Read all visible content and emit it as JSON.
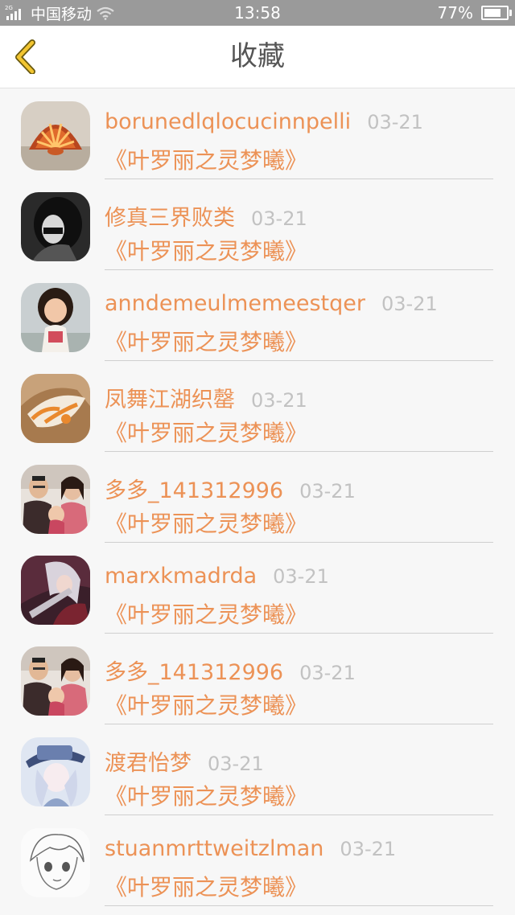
{
  "status_bar": {
    "network": "2G",
    "carrier": "中国移动",
    "time": "13:58",
    "battery": "77%",
    "battery_level": 0.77
  },
  "nav": {
    "title": "收藏",
    "back_icon": "chevron-left-icon",
    "accent_color": "#f1c40f"
  },
  "colors": {
    "accent": "#ec9256",
    "date": "#c2c2c2"
  },
  "items": [
    {
      "username": "borunedlqlocucinnpelli",
      "date": "03-21",
      "book": "《叶罗丽之灵梦曦》",
      "avatar": "seashell-avatar"
    },
    {
      "username": "修真三界败类",
      "date": "03-21",
      "book": "《叶罗丽之灵梦曦》",
      "avatar": "girl-bw-avatar"
    },
    {
      "username": "anndemeulmemeestqer",
      "date": "03-21",
      "book": "《叶罗丽之灵梦曦》",
      "avatar": "child-photo-avatar"
    },
    {
      "username": "凤舞江湖织罄",
      "date": "03-21",
      "book": "《叶罗丽之灵梦曦》",
      "avatar": "seashell-orange-avatar"
    },
    {
      "username": "多多_141312996",
      "date": "03-21",
      "book": "《叶罗丽之灵梦曦》",
      "avatar": "family-photo-avatar"
    },
    {
      "username": "marxkmadrda",
      "date": "03-21",
      "book": "《叶罗丽之灵梦曦》",
      "avatar": "anime-warrior-avatar"
    },
    {
      "username": "多多_141312996",
      "date": "03-21",
      "book": "《叶罗丽之灵梦曦》",
      "avatar": "family-photo-avatar"
    },
    {
      "username": "渡君怡梦",
      "date": "03-21",
      "book": "《叶罗丽之灵梦曦》",
      "avatar": "anime-hat-avatar"
    },
    {
      "username": "stuanmrttweitzlman",
      "date": "03-21",
      "book": "《叶罗丽之灵梦曦》",
      "avatar": "anime-sketch-avatar"
    }
  ]
}
